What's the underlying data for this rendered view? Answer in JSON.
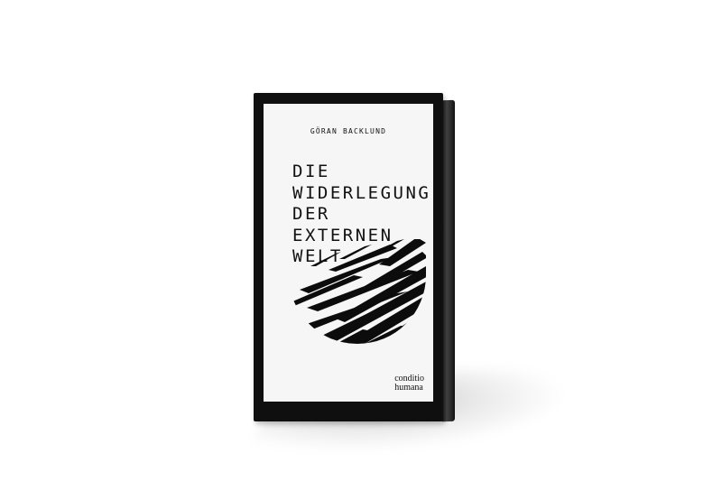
{
  "book": {
    "author": "GÖRAN BACKLUND",
    "title_lines": [
      "DIE",
      "WIDERLEGUNG",
      "DER",
      "EXTERNEN",
      "WELT"
    ],
    "publisher_lines": [
      "conditio",
      "humana"
    ],
    "cover_color": "#0f0f0f",
    "page_color": "#f6f6f6"
  }
}
